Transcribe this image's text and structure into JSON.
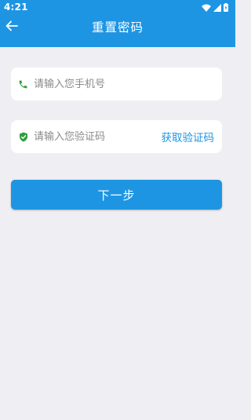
{
  "status_bar": {
    "time": "4:21",
    "icons": [
      "wifi-icon",
      "signal-icon",
      "battery-icon"
    ]
  },
  "app_bar": {
    "back_icon": "arrow-left-icon",
    "title": "重置密码"
  },
  "form": {
    "phone": {
      "icon": "phone-icon",
      "value": "",
      "placeholder": "请输入您手机号"
    },
    "code": {
      "icon": "shield-check-icon",
      "value": "",
      "placeholder": "请输入您验证码",
      "get_code_label": "获取验证码"
    },
    "next_button_label": "下一步"
  },
  "colors": {
    "primary": "#1e95e3",
    "background": "#eeeef3",
    "field_background": "#ffffff",
    "icon_green": "#2e9e3e",
    "placeholder": "#8a8a8a"
  }
}
